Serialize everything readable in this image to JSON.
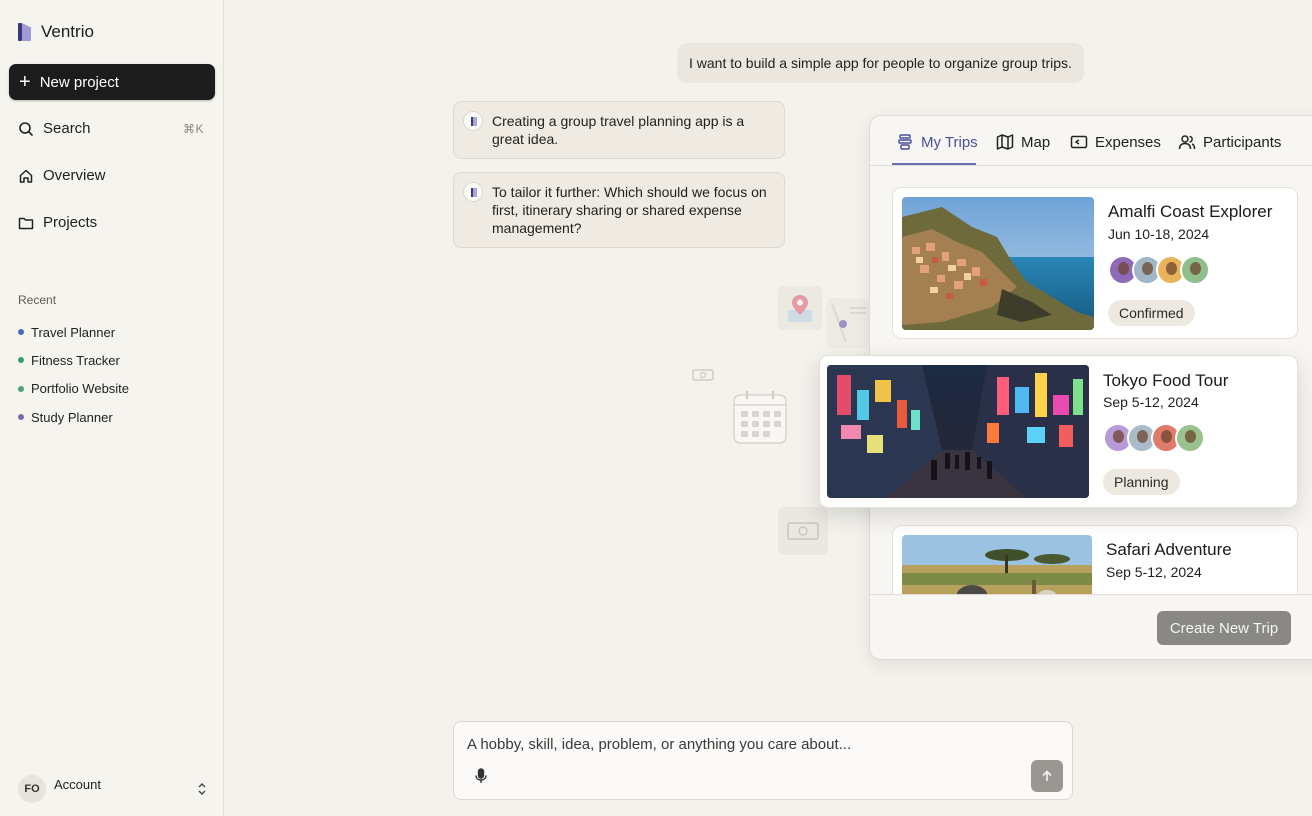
{
  "app": {
    "name": "Ventrio"
  },
  "sidebar": {
    "new_project_label": "New project",
    "search_label": "Search",
    "search_shortcut": "⌘K",
    "overview_label": "Overview",
    "projects_label": "Projects",
    "recent_heading": "Recent",
    "recent_items": [
      {
        "label": "Travel Planner",
        "dot_color": "#4a67b8"
      },
      {
        "label": "Fitness Tracker",
        "dot_color": "#3f9a6a"
      },
      {
        "label": "Portfolio Website",
        "dot_color": "#4aa37b"
      },
      {
        "label": "Study Planner",
        "dot_color": "#7b6aa8"
      }
    ],
    "account": {
      "initials": "FO",
      "label": "Account"
    }
  },
  "chat": {
    "user_message": "I want to build a simple app for people to organize group trips.",
    "bot_messages": [
      "Creating a group travel planning app is a great idea.",
      "To tailor it further: Which should we focus on first, itinerary sharing or shared expense management?"
    ]
  },
  "preview": {
    "tabs": [
      {
        "label": "My Trips",
        "icon": "trips-icon",
        "active": true
      },
      {
        "label": "Map",
        "icon": "map-icon",
        "active": false
      },
      {
        "label": "Expenses",
        "icon": "wallet-icon",
        "active": false
      },
      {
        "label": "Participants",
        "icon": "people-icon",
        "active": false
      }
    ],
    "trips": [
      {
        "title": "Amalfi Coast Explorer",
        "dates": "Jun 10-18, 2024",
        "status": "Confirmed"
      },
      {
        "title": "Tokyo Food Tour",
        "dates": "Sep 5-12, 2024",
        "status": "Planning"
      },
      {
        "title": "Safari Adventure",
        "dates": "Sep 5-12, 2024",
        "status": ""
      }
    ],
    "create_button_label": "Create New Trip"
  },
  "composer": {
    "placeholder": "A hobby, skill, idea, problem, or anything you care about..."
  },
  "colors": {
    "accent": "#4b4f9e",
    "background": "#f4f2ec",
    "primary_button": "#1c1c1c"
  }
}
